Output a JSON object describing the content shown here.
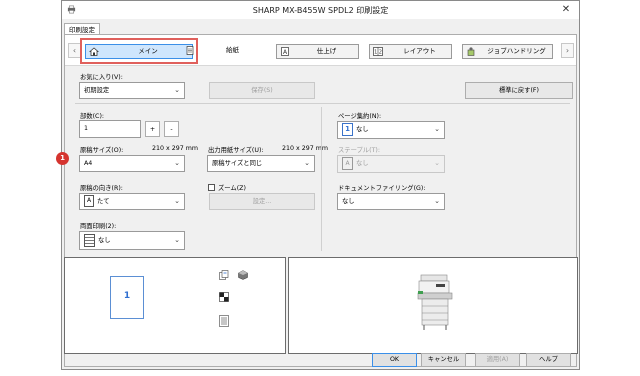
{
  "window": {
    "title": "SHARP MX-B455W SPDL2 印刷設定"
  },
  "tab_label": "印刷設定",
  "ribbon": {
    "tabs": [
      {
        "label": "メイン"
      },
      {
        "label": "給紙"
      },
      {
        "label": "仕上げ"
      },
      {
        "label": "レイアウト"
      },
      {
        "label": "ジョブハンドリング"
      }
    ]
  },
  "favorites": {
    "label": "お気に入り(V):",
    "value": "初期設定",
    "save_button": "保存(S)",
    "reset_button": "標準に戻す(F)"
  },
  "copies": {
    "label": "部数(C):",
    "value": "1",
    "plus": "+",
    "minus": "-"
  },
  "original_size": {
    "label": "原稿サイズ(O):",
    "dims": "210 x 297 mm",
    "value": "A4"
  },
  "output_size": {
    "label": "出力用紙サイズ(U):",
    "dims": "210 x 297 mm",
    "value": "原稿サイズと同じ"
  },
  "orientation": {
    "label": "原稿の向き(R):",
    "value": "たて",
    "icon_letter": "A"
  },
  "zoom": {
    "label": "ズーム(Z)",
    "settings_button": "設定..."
  },
  "duplex": {
    "label": "両面印刷(2):",
    "value": "なし"
  },
  "pages_per_sheet": {
    "label": "ページ集約(N):",
    "value": "なし",
    "icon_number": "1"
  },
  "staple": {
    "label": "ステープル(T):",
    "value": "なし",
    "icon_letter": "A"
  },
  "document_filing": {
    "label": "ドキュメントファイリング(G):",
    "value": "なし"
  },
  "preview": {
    "page_number": "1"
  },
  "callout": {
    "number": "1"
  },
  "buttons": {
    "ok": "OK",
    "cancel": "キャンセル",
    "apply": "適用(A)",
    "help": "ヘルプ"
  },
  "colors": {
    "highlight": "#e0605c",
    "badge": "#d5342f",
    "active_tab": "#cfe6fd"
  }
}
